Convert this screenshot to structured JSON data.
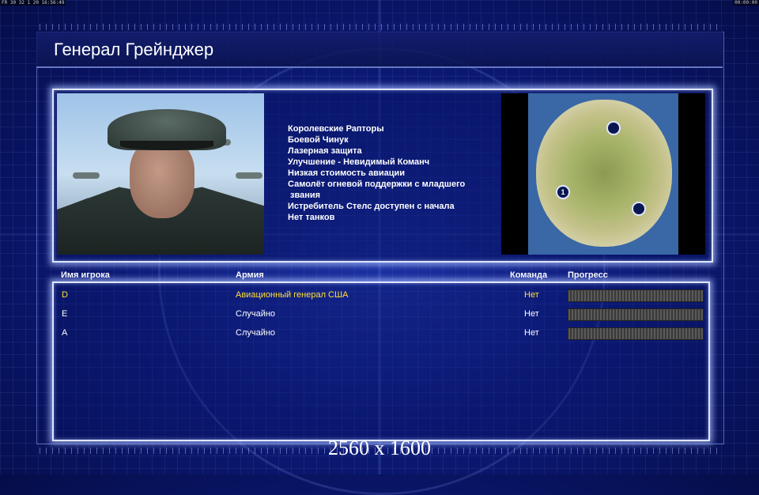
{
  "statusbar": {
    "left_text": "FR 30 32 1 20 16:56:49",
    "right_text": "00:00:00"
  },
  "title": "Генерал Грейнджер",
  "general": {
    "perks": [
      "Королевские Рапторы",
      "Боевой Чинук",
      "Лазерная защита",
      "Улучшение - Невидимый Команч",
      "Низкая стоимость авиации",
      "Самолёт огневой поддержки с младшего",
      " звания",
      "Истребитель Стелс доступен с начала",
      "Нет танков"
    ]
  },
  "minimap": {
    "markers": [
      "",
      "1",
      ""
    ]
  },
  "table": {
    "headers": {
      "name": "Имя игрока",
      "army": "Армия",
      "team": "Команда",
      "progress": "Прогресс"
    },
    "rows": [
      {
        "name": "D",
        "army": "Авиационный генерал США",
        "team": "Нет",
        "highlight": true
      },
      {
        "name": "E",
        "army": "Случайно",
        "team": "Нет",
        "highlight": false
      },
      {
        "name": "A",
        "army": "Случайно",
        "team": "Нет",
        "highlight": false
      }
    ]
  },
  "resolution_label": "2560 x 1600",
  "colors": {
    "background": "#0c1a78",
    "highlight_text": "#ffe033",
    "panel_border": "#dfe6ff"
  }
}
